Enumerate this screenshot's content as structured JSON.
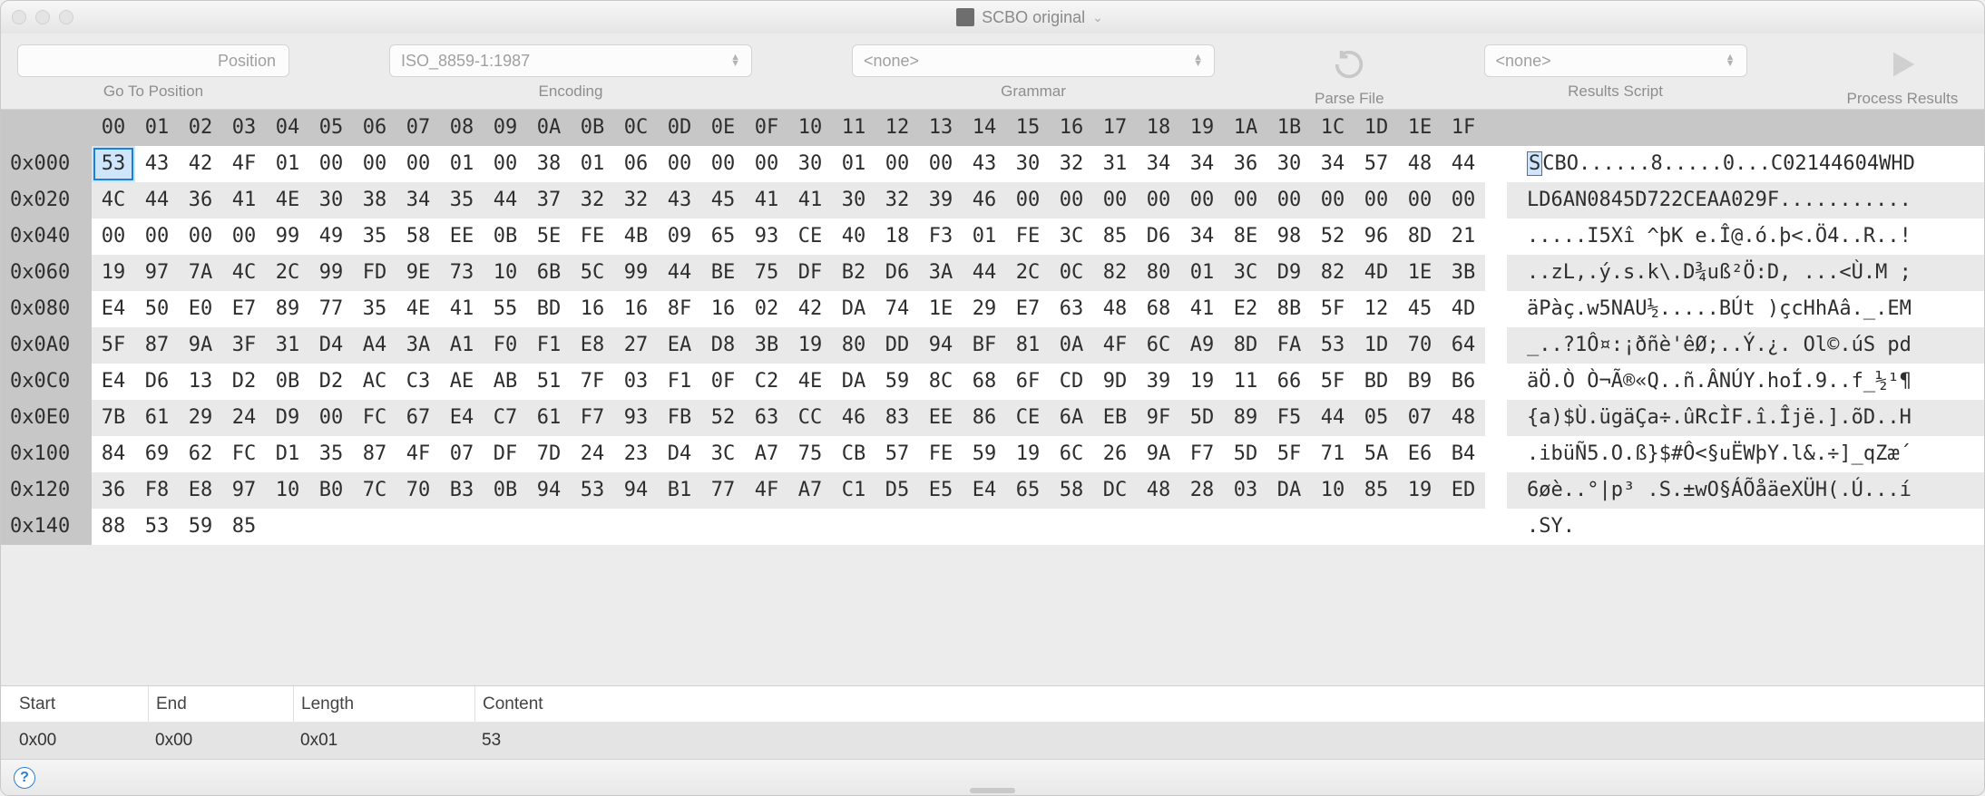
{
  "window": {
    "title": "SCBO original"
  },
  "toolbar": {
    "position": {
      "placeholder": "Position",
      "label": "Go To Position"
    },
    "encoding": {
      "value": "ISO_8859-1:1987",
      "label": "Encoding"
    },
    "grammar": {
      "value": "<none>",
      "label": "Grammar"
    },
    "parse": {
      "label": "Parse File"
    },
    "script": {
      "value": "<none>",
      "label": "Results Script"
    },
    "process": {
      "label": "Process Results"
    }
  },
  "hex": {
    "col_headers": [
      "00",
      "01",
      "02",
      "03",
      "04",
      "05",
      "06",
      "07",
      "08",
      "09",
      "0A",
      "0B",
      "0C",
      "0D",
      "0E",
      "0F",
      "10",
      "11",
      "12",
      "13",
      "14",
      "15",
      "16",
      "17",
      "18",
      "19",
      "1A",
      "1B",
      "1C",
      "1D",
      "1E",
      "1F"
    ],
    "rows": [
      {
        "addr": "0x000",
        "bytes": [
          "53",
          "43",
          "42",
          "4F",
          "01",
          "00",
          "00",
          "00",
          "01",
          "00",
          "38",
          "01",
          "06",
          "00",
          "00",
          "00",
          "30",
          "01",
          "00",
          "00",
          "43",
          "30",
          "32",
          "31",
          "34",
          "34",
          "36",
          "30",
          "34",
          "57",
          "48",
          "44"
        ],
        "ascii": "SCBO......8.....0...C02144604WHD",
        "sel": 0
      },
      {
        "addr": "0x020",
        "bytes": [
          "4C",
          "44",
          "36",
          "41",
          "4E",
          "30",
          "38",
          "34",
          "35",
          "44",
          "37",
          "32",
          "32",
          "43",
          "45",
          "41",
          "41",
          "30",
          "32",
          "39",
          "46",
          "00",
          "00",
          "00",
          "00",
          "00",
          "00",
          "00",
          "00",
          "00",
          "00",
          "00"
        ],
        "ascii": "LD6AN0845D722CEAA029F..........."
      },
      {
        "addr": "0x040",
        "bytes": [
          "00",
          "00",
          "00",
          "00",
          "99",
          "49",
          "35",
          "58",
          "EE",
          "0B",
          "5E",
          "FE",
          "4B",
          "09",
          "65",
          "93",
          "CE",
          "40",
          "18",
          "F3",
          "01",
          "FE",
          "3C",
          "85",
          "D6",
          "34",
          "8E",
          "98",
          "52",
          "96",
          "8D",
          "21"
        ],
        "ascii": ".....I5Xî ^þK e.Î@.ó.þ<.Ö4..R..!"
      },
      {
        "addr": "0x060",
        "bytes": [
          "19",
          "97",
          "7A",
          "4C",
          "2C",
          "99",
          "FD",
          "9E",
          "73",
          "10",
          "6B",
          "5C",
          "99",
          "44",
          "BE",
          "75",
          "DF",
          "B2",
          "D6",
          "3A",
          "44",
          "2C",
          "0C",
          "82",
          "80",
          "01",
          "3C",
          "D9",
          "82",
          "4D",
          "1E",
          "3B"
        ],
        "ascii": "..zL,.ý.s.k\\.D¾uß²Ö:D, ...<Ù.M ;"
      },
      {
        "addr": "0x080",
        "bytes": [
          "E4",
          "50",
          "E0",
          "E7",
          "89",
          "77",
          "35",
          "4E",
          "41",
          "55",
          "BD",
          "16",
          "16",
          "8F",
          "16",
          "02",
          "42",
          "DA",
          "74",
          "1E",
          "29",
          "E7",
          "63",
          "48",
          "68",
          "41",
          "E2",
          "8B",
          "5F",
          "12",
          "45",
          "4D"
        ],
        "ascii": "äPàç.w5NAU½.....BÚt )çcHhAâ._.EM"
      },
      {
        "addr": "0x0A0",
        "bytes": [
          "5F",
          "87",
          "9A",
          "3F",
          "31",
          "D4",
          "A4",
          "3A",
          "A1",
          "F0",
          "F1",
          "E8",
          "27",
          "EA",
          "D8",
          "3B",
          "19",
          "80",
          "DD",
          "94",
          "BF",
          "81",
          "0A",
          "4F",
          "6C",
          "A9",
          "8D",
          "FA",
          "53",
          "1D",
          "70",
          "64"
        ],
        "ascii": "_..?1Ô¤:¡ðñè'êØ;..Ý.¿. Ol©.úS pd"
      },
      {
        "addr": "0x0C0",
        "bytes": [
          "E4",
          "D6",
          "13",
          "D2",
          "0B",
          "D2",
          "AC",
          "C3",
          "AE",
          "AB",
          "51",
          "7F",
          "03",
          "F1",
          "0F",
          "C2",
          "4E",
          "DA",
          "59",
          "8C",
          "68",
          "6F",
          "CD",
          "9D",
          "39",
          "19",
          "11",
          "66",
          "5F",
          "BD",
          "B9",
          "B6"
        ],
        "ascii": "äÖ.Ò Ò¬Ã®«Q..ñ.ÂNÚY.hoÍ.9..f_½¹¶"
      },
      {
        "addr": "0x0E0",
        "bytes": [
          "7B",
          "61",
          "29",
          "24",
          "D9",
          "00",
          "FC",
          "67",
          "E4",
          "C7",
          "61",
          "F7",
          "93",
          "FB",
          "52",
          "63",
          "CC",
          "46",
          "83",
          "EE",
          "86",
          "CE",
          "6A",
          "EB",
          "9F",
          "5D",
          "89",
          "F5",
          "44",
          "05",
          "07",
          "48"
        ],
        "ascii": "{a)$Ù.ügäÇa÷.ûRcÌF.î.Îjë.].õD..H"
      },
      {
        "addr": "0x100",
        "bytes": [
          "84",
          "69",
          "62",
          "FC",
          "D1",
          "35",
          "87",
          "4F",
          "07",
          "DF",
          "7D",
          "24",
          "23",
          "D4",
          "3C",
          "A7",
          "75",
          "CB",
          "57",
          "FE",
          "59",
          "19",
          "6C",
          "26",
          "9A",
          "F7",
          "5D",
          "5F",
          "71",
          "5A",
          "E6",
          "B4"
        ],
        "ascii": ".ibüÑ5.O.ß}$#Ô<§uËWþY.l&.÷]_qZæ´"
      },
      {
        "addr": "0x120",
        "bytes": [
          "36",
          "F8",
          "E8",
          "97",
          "10",
          "B0",
          "7C",
          "70",
          "B3",
          "0B",
          "94",
          "53",
          "94",
          "B1",
          "77",
          "4F",
          "A7",
          "C1",
          "D5",
          "E5",
          "E4",
          "65",
          "58",
          "DC",
          "48",
          "28",
          "03",
          "DA",
          "10",
          "85",
          "19",
          "ED"
        ],
        "ascii": "6øè..°|p³ .S.±wO§ÁÕåäeXÜH(.Ú...í"
      },
      {
        "addr": "0x140",
        "bytes": [
          "88",
          "53",
          "59",
          "85"
        ],
        "ascii": ".SY."
      }
    ]
  },
  "info": {
    "headers": [
      "Start",
      "End",
      "Length",
      "Content"
    ],
    "row": {
      "start": "0x00",
      "end": "0x00",
      "length": "0x01",
      "content": "53"
    }
  }
}
